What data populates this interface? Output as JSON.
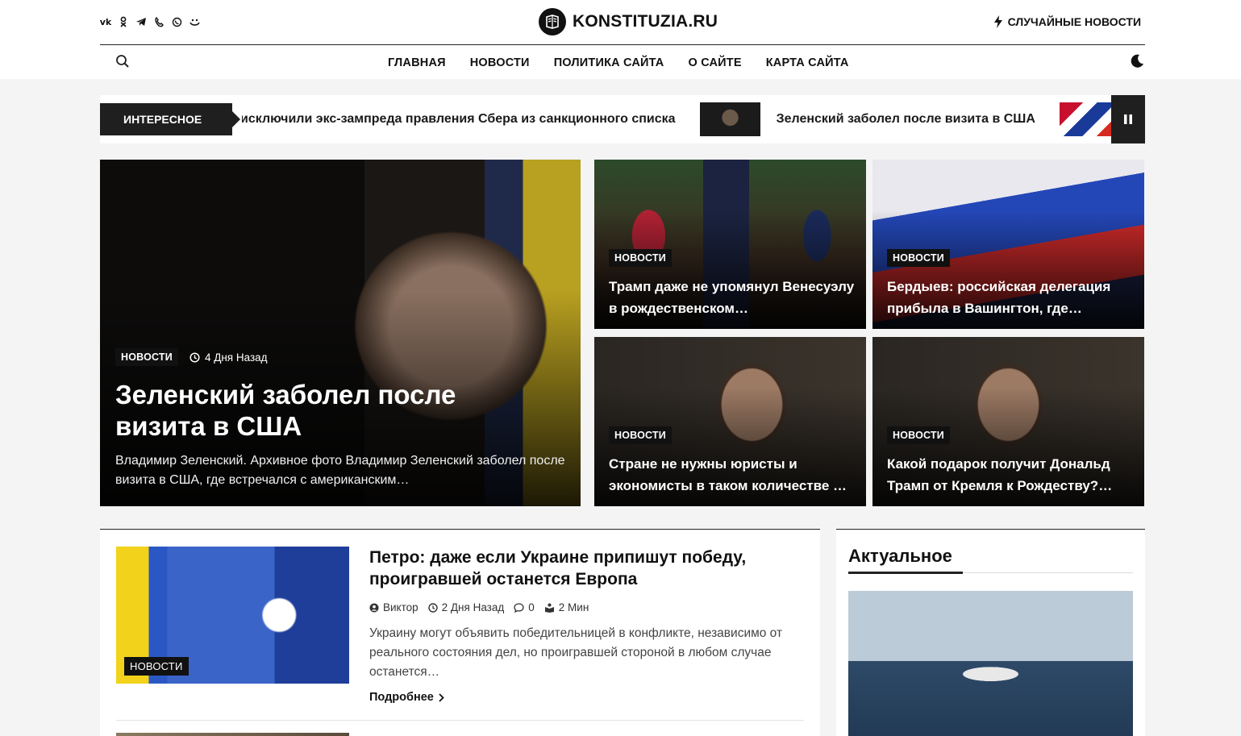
{
  "site": {
    "logo_text": "KONSTITUZIA.RU",
    "random_news": "СЛУЧАЙНЫЕ НОВОСТИ"
  },
  "social": [
    "vk",
    "ok",
    "telegram",
    "viber",
    "whatsapp",
    "yandex"
  ],
  "nav": [
    "ГЛАВНАЯ",
    "НОВОСТИ",
    "ПОЛИТИКА САЙТА",
    "О САЙТЕ",
    "КАРТА САЙТА"
  ],
  "ticker": {
    "label": "ИНТЕРЕСНОЕ",
    "items": [
      "исключили экс-зампреда правления Сбера из санкционного списка",
      "Зеленский заболел после визита в США"
    ]
  },
  "hero": {
    "category": "НОВОСТИ",
    "time": "4 Дня Назад",
    "title": "Зеленский заболел после визита в США",
    "excerpt": "Владимир Зеленский. Архивное фото Владимир Зеленский заболел после визита в США, где встречался с американским…"
  },
  "cards": [
    {
      "category": "НОВОСТИ",
      "title": "Трамп даже не упомянул Венесуэлу в рождественском…"
    },
    {
      "category": "НОВОСТИ",
      "title": "Бердыев: российская делегация прибыла в Вашингтон, где…"
    },
    {
      "category": "НОВОСТИ",
      "title": "Стране не нужны юристы и экономисты в таком количестве …"
    },
    {
      "category": "НОВОСТИ",
      "title": "Какой подарок получит Дональд Трамп от Кремля к Рождеству?…"
    }
  ],
  "post": {
    "category": "НОВОСТИ",
    "title": "Петро: даже если Украине припишут победу, проигравшей останется Европа",
    "author": "Виктор",
    "time": "2 Дня Назад",
    "comments": "0",
    "read_time": "2 Мин",
    "excerpt": "Украину могут объявить победительницей в конфликте, независимо от реального состояния дел, но проигравшей стороной в любом случае останется…",
    "read_more": "Подробнее"
  },
  "sidebar": {
    "title": "Актуальное"
  }
}
